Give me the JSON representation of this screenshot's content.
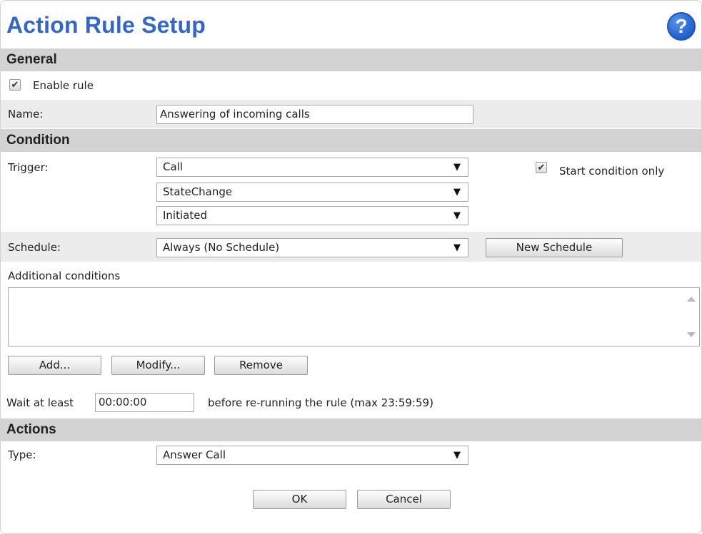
{
  "title": "Action Rule Setup",
  "help_symbol": "?",
  "general": {
    "header": "General",
    "enable_rule_label": "Enable rule",
    "enable_rule_checked": true,
    "name_label": "Name:",
    "name_value": "Answering of incoming calls"
  },
  "condition": {
    "header": "Condition",
    "trigger_label": "Trigger:",
    "trigger_selects": [
      "Call",
      "StateChange",
      "Initiated"
    ],
    "start_condition_label": "Start condition only",
    "start_condition_checked": true,
    "schedule_label": "Schedule:",
    "schedule_value": "Always (No Schedule)",
    "new_schedule_label": "New Schedule",
    "additional_conditions_label": "Additional conditions",
    "add_label": "Add...",
    "modify_label": "Modify...",
    "remove_label": "Remove",
    "wait_prefix": "Wait at least",
    "wait_value": "00:00:00",
    "wait_suffix": "before re-running the rule (max 23:59:59)"
  },
  "actions": {
    "header": "Actions",
    "type_label": "Type:",
    "type_value": "Answer Call"
  },
  "footer": {
    "ok_label": "OK",
    "cancel_label": "Cancel"
  },
  "icons": {
    "help": "help-icon",
    "check": "checkmark-icon",
    "dropdown": "chevron-down-icon",
    "scroll_up": "scroll-up-icon",
    "scroll_down": "scroll-down-icon"
  },
  "colors": {
    "title": "#3366cc",
    "section_header_bg": "#d3d3d3",
    "band_bg": "#ececec",
    "help_icon": "#2a6ad6"
  }
}
